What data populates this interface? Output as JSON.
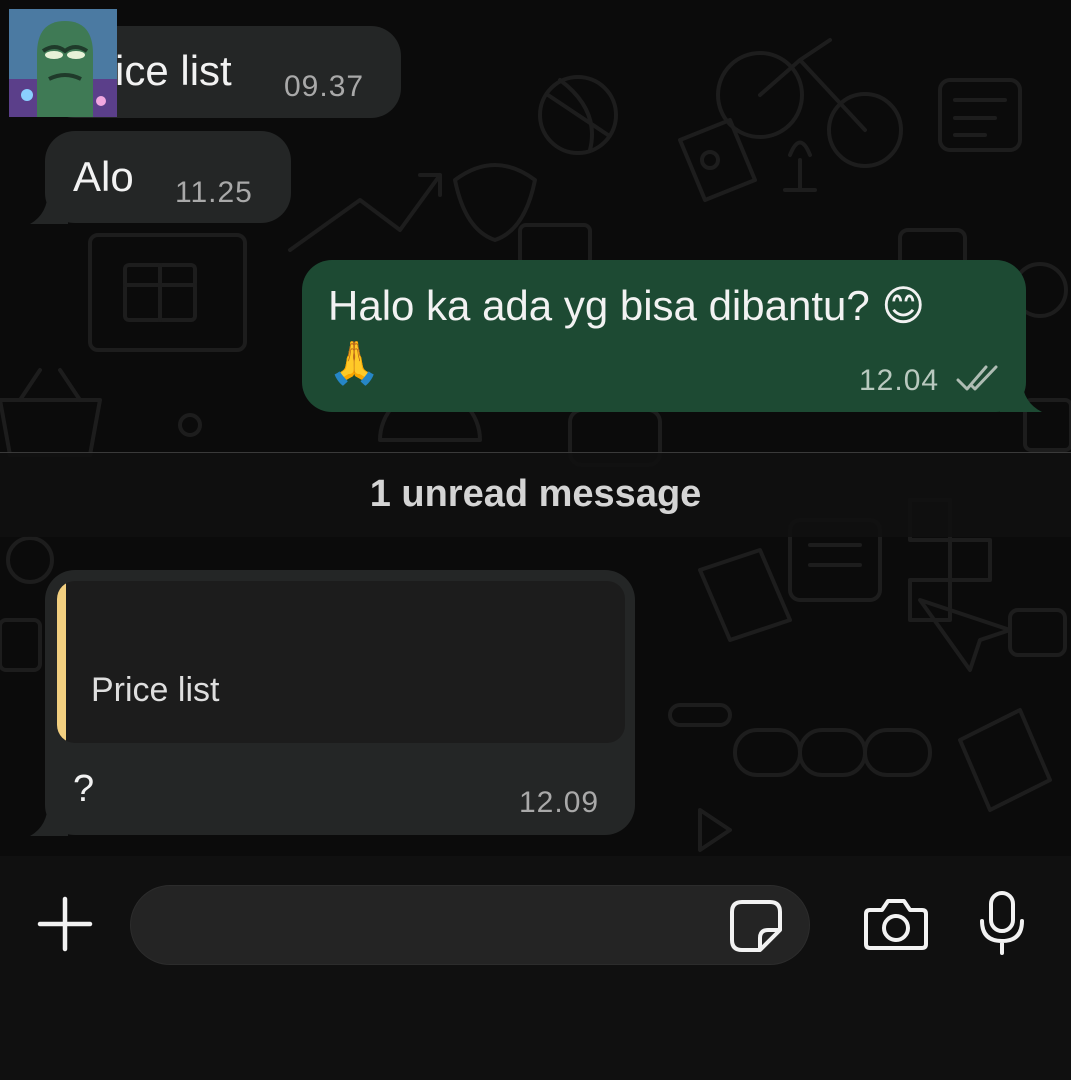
{
  "messages": [
    {
      "id": "m1",
      "direction": "incoming",
      "text": "Price list",
      "time": "09.37"
    },
    {
      "id": "m2",
      "direction": "incoming",
      "text": "Alo",
      "time": "11.25"
    },
    {
      "id": "m3",
      "direction": "outgoing",
      "text": "Halo ka ada yg bisa dibantu? 😊",
      "emoji_line": "🙏",
      "time": "12.04",
      "status_icon": "double-check-icon"
    },
    {
      "id": "m4",
      "direction": "incoming",
      "quoted_text": "Price list",
      "text": "?",
      "time": "12.09"
    }
  ],
  "unread_divider": {
    "label": "1 unread message"
  },
  "composer": {
    "input_value": "",
    "icons": [
      "plus-icon",
      "sticker-icon",
      "camera-icon",
      "microphone-icon"
    ]
  },
  "colors": {
    "background": "#0b0b0b",
    "incoming_bubble": "#242626",
    "outgoing_bubble": "#1d4a33",
    "quote_accent": "#f2cf80"
  }
}
